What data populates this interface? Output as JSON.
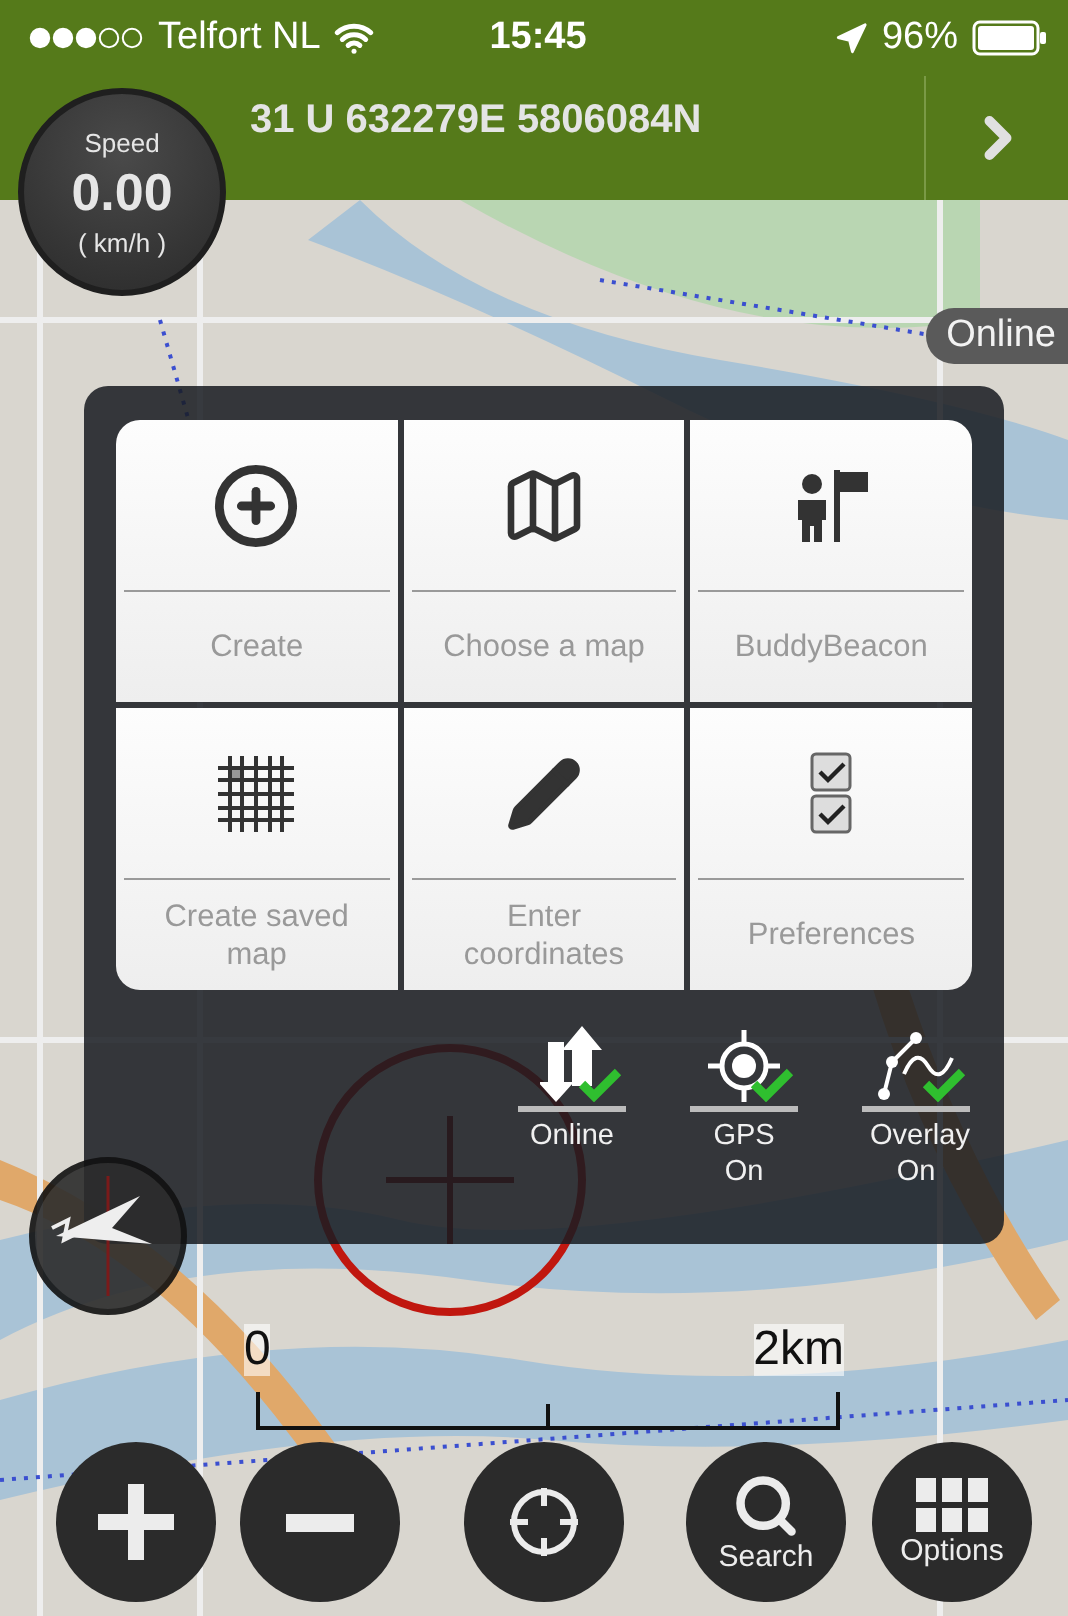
{
  "status_bar": {
    "carrier": "Telfort NL",
    "time": "15:45",
    "battery": "96%"
  },
  "header": {
    "coordinates": "31 U 632279E 5806084N"
  },
  "speed": {
    "label": "Speed",
    "value": "0.00",
    "unit": "( km/h )"
  },
  "map": {
    "mode_badge": "Online",
    "scale": {
      "start": "0",
      "end": "2km"
    }
  },
  "menu": {
    "tiles": [
      {
        "label": "Create"
      },
      {
        "label": "Choose a map"
      },
      {
        "label": "BuddyBeacon"
      },
      {
        "label": "Create saved map"
      },
      {
        "label": "Enter coordinates"
      },
      {
        "label": "Preferences"
      }
    ],
    "toggles": [
      {
        "label": "Online",
        "on": true
      },
      {
        "label": "GPS On",
        "on": true
      },
      {
        "label": "Overlay On",
        "on": true
      }
    ]
  },
  "bottom_bar": {
    "buttons": [
      {
        "kind": "zoom-in"
      },
      {
        "kind": "zoom-out"
      },
      {
        "kind": "locate"
      },
      {
        "kind": "search",
        "label": "Search"
      },
      {
        "kind": "options",
        "label": "Options"
      }
    ]
  }
}
